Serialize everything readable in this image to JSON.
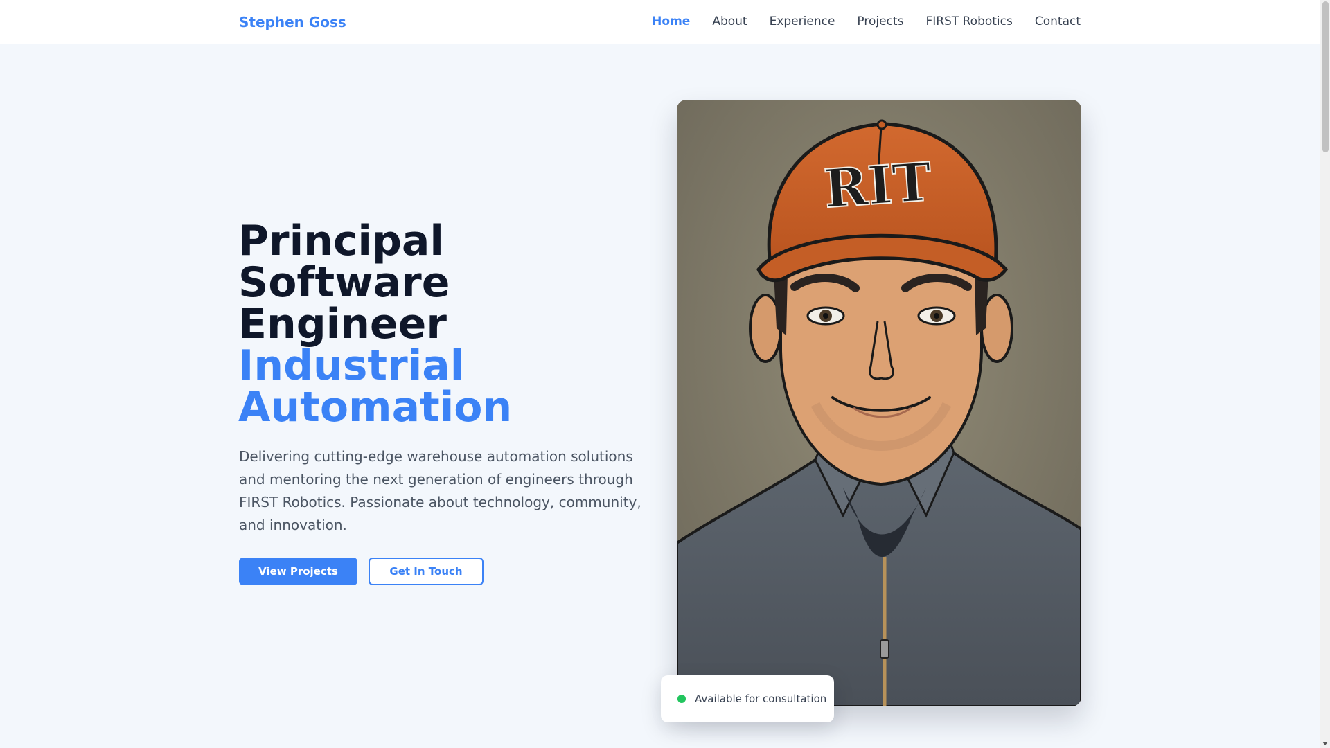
{
  "header": {
    "brand": "Stephen Goss",
    "nav": [
      {
        "label": "Home",
        "active": true
      },
      {
        "label": "About",
        "active": false
      },
      {
        "label": "Experience",
        "active": false
      },
      {
        "label": "Projects",
        "active": false
      },
      {
        "label": "FIRST Robotics",
        "active": false
      },
      {
        "label": "Contact",
        "active": false
      }
    ]
  },
  "hero": {
    "title_lines": [
      "Principal",
      "Software",
      "Engineer"
    ],
    "accent_lines": [
      "Industrial",
      "Automation"
    ],
    "description": "Delivering cutting-edge warehouse automation solutions and mentoring the next generation of engineers through FIRST Robotics. Passionate about technology, community, and innovation.",
    "primary_button": "View Projects",
    "secondary_button": "Get In Touch"
  },
  "portrait": {
    "cap_text": "RIT"
  },
  "badge": {
    "text": "Available for consultation"
  },
  "colors": {
    "accent": "#3b82f6",
    "heading": "#0f172a",
    "body_text": "#4b5563",
    "status": "#22c55e",
    "background": "#f3f7fc"
  }
}
